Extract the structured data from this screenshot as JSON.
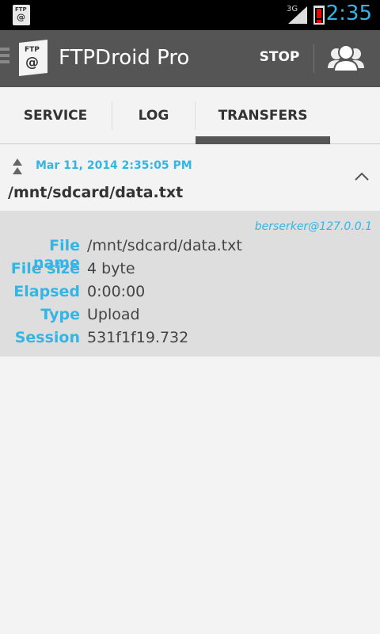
{
  "status_bar": {
    "network": "3G",
    "time": "2:35"
  },
  "action_bar": {
    "title": "FTPDroid Pro",
    "stop_label": "STOP",
    "logo_text": "FTP",
    "logo_symbol": "@"
  },
  "tabs": [
    {
      "label": "SERVICE"
    },
    {
      "label": "LOG"
    },
    {
      "label": "TRANSFERS",
      "selected": true
    }
  ],
  "transfer": {
    "date": "Mar 11, 2014 2:35:05 PM",
    "path": "/mnt/sdcard/data.txt",
    "user": "berserker@127.0.0.1",
    "details": [
      {
        "label": "File name",
        "value": "/mnt/sdcard/data.txt"
      },
      {
        "label": "File size",
        "value": "4 byte"
      },
      {
        "label": "Elapsed",
        "value": "0:00:00"
      },
      {
        "label": "Type",
        "value": "Upload"
      },
      {
        "label": "Session",
        "value": "531f1f19.732"
      }
    ]
  },
  "colors": {
    "accent": "#33b5e5",
    "actionbar": "#555555",
    "details_bg": "#dedede"
  }
}
